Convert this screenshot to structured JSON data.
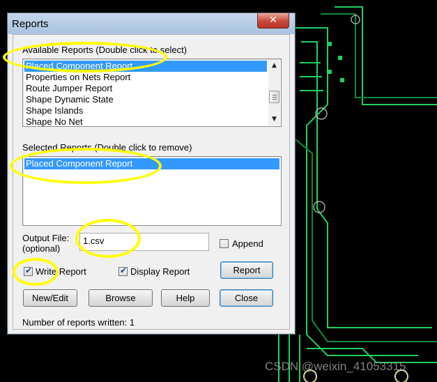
{
  "dialog": {
    "title": "Reports",
    "close_glyph": "✕",
    "available_label": "Available Reports (Double click to select)",
    "available_items": [
      "Placed Component Report",
      "Properties on Nets Report",
      "Route Jumper Report",
      "Shape Dynamic State",
      "Shape Islands",
      "Shape No Net"
    ],
    "available_selected_index": 0,
    "selected_label": "Selected Reports (Double click to remove)",
    "selected_items": [
      "Placed Component Report"
    ],
    "output_file_label_line1": "Output File:",
    "output_file_label_line2": "(optional)",
    "output_file_value": "1.csv",
    "append_label": "Append",
    "append_checked": false,
    "write_report_label": "Write Report",
    "write_report_checked": true,
    "display_report_label": "Display Report",
    "display_report_checked": true,
    "report_button": "Report",
    "new_edit_button": "New/Edit",
    "browse_button": "Browse",
    "help_button": "Help",
    "close_button": "Close",
    "status_text": "Number of reports written: 1",
    "check_glyph": "✔"
  },
  "scroll_icons": {
    "up": "▲",
    "down": "▼"
  },
  "watermark": "CSDN @weixin_41053315",
  "colors": {
    "highlight": "#ffff00",
    "selection": "#3399ff",
    "pcb_trace": "#1fd060",
    "pcb_background": "#000000"
  }
}
